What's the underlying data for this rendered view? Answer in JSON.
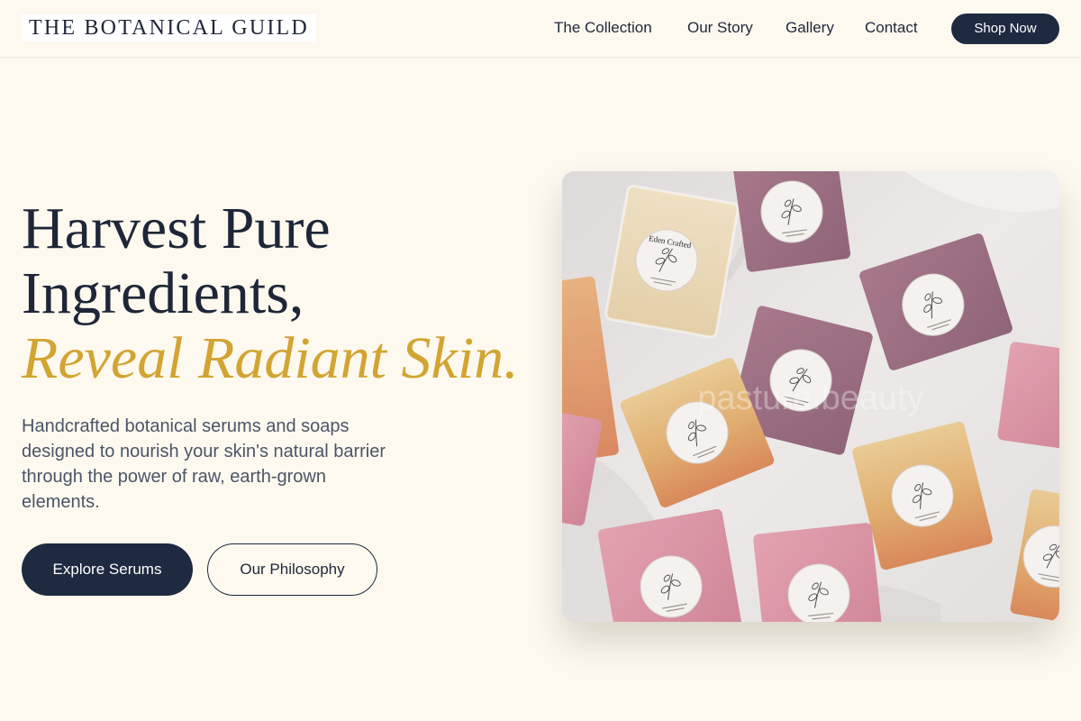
{
  "header": {
    "logo": "THE BOTANICAL GUILD",
    "nav": [
      {
        "label": "The Collection"
      },
      {
        "label": "Our Story"
      },
      {
        "label": "Gallery"
      },
      {
        "label": "Contact"
      }
    ],
    "cta": "Shop Now"
  },
  "hero": {
    "title_line1": "Harvest Pure",
    "title_line2": "Ingredients,",
    "title_line3": "Reveal Radiant Skin.",
    "description": "Handcrafted botanical serums and soaps designed to nourish your skin's natural barrier through the power of raw, earth-grown elements.",
    "primary_button": "Explore Serums",
    "secondary_button": "Our Philosophy",
    "image": {
      "label_text": "Eden Crafted",
      "watermark": "pasture.beauty"
    }
  },
  "colors": {
    "background": "#fdf9ef",
    "navy": "#1e2a40",
    "gold_accent": "#d2a431",
    "body_text": "#4b5567"
  }
}
